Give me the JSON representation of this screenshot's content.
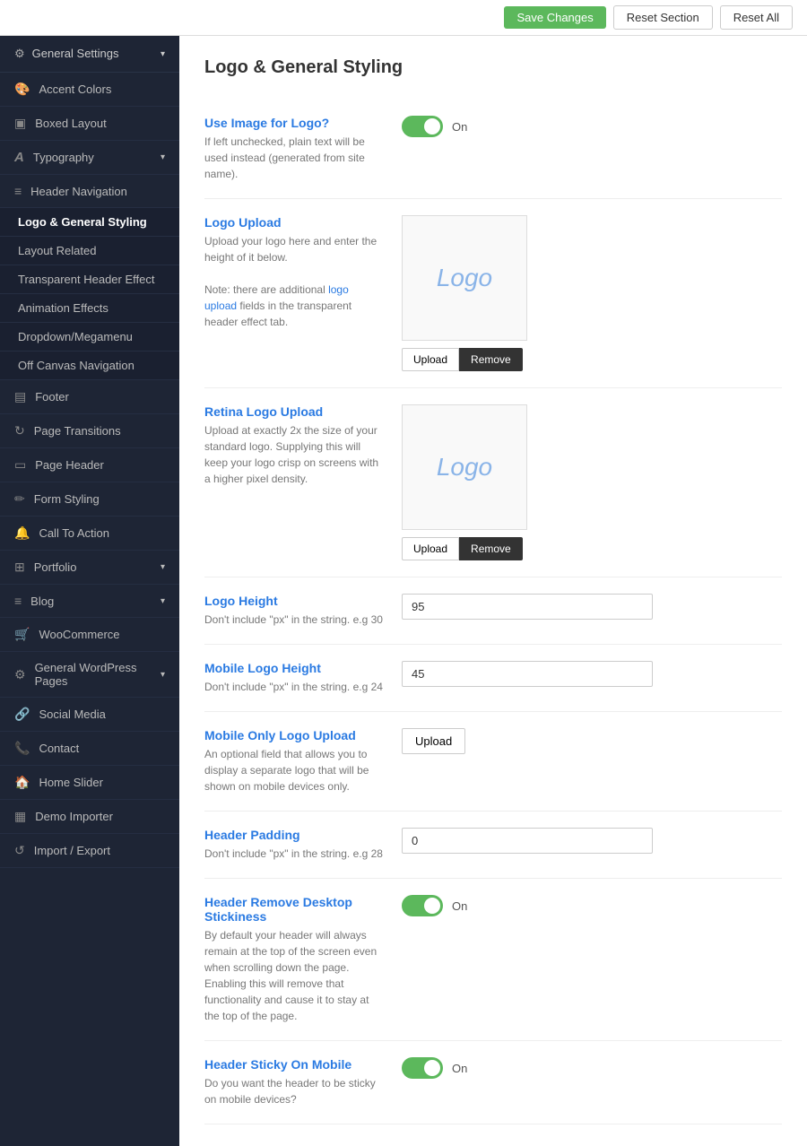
{
  "topbar": {
    "save_label": "Save Changes",
    "reset_section_label": "Reset Section",
    "reset_all_label": "Reset All"
  },
  "sidebar": {
    "section_title": "General Settings",
    "items": [
      {
        "id": "accent-colors",
        "label": "Accent Colors",
        "icon": "🎨"
      },
      {
        "id": "boxed-layout",
        "label": "Boxed Layout",
        "icon": "▣"
      },
      {
        "id": "typography",
        "label": "Typography",
        "icon": "A",
        "has_chevron": true
      },
      {
        "id": "header-navigation",
        "label": "Header Navigation",
        "icon": "≡"
      },
      {
        "id": "logo-general-styling",
        "label": "Logo & General Styling",
        "icon": null,
        "active": true
      },
      {
        "id": "layout-related",
        "label": "Layout Related",
        "icon": null
      },
      {
        "id": "transparent-header-effect",
        "label": "Transparent Header Effect",
        "icon": null
      },
      {
        "id": "animation-effects",
        "label": "Animation Effects",
        "icon": null
      },
      {
        "id": "dropdown-megamenu",
        "label": "Dropdown/Megamenu",
        "icon": null
      },
      {
        "id": "off-canvas-navigation",
        "label": "Off Canvas Navigation",
        "icon": null
      },
      {
        "id": "footer",
        "label": "Footer",
        "icon": "▤"
      },
      {
        "id": "page-transitions",
        "label": "Page Transitions",
        "icon": "↻"
      },
      {
        "id": "page-header",
        "label": "Page Header",
        "icon": "▭"
      },
      {
        "id": "form-styling",
        "label": "Form Styling",
        "icon": "✏"
      },
      {
        "id": "call-to-action",
        "label": "Call To Action",
        "icon": "🔔"
      },
      {
        "id": "portfolio",
        "label": "Portfolio",
        "icon": "⊞",
        "has_chevron": true
      },
      {
        "id": "blog",
        "label": "Blog",
        "icon": "≡",
        "has_chevron": true
      },
      {
        "id": "woocommerce",
        "label": "WooCommerce",
        "icon": "🛒"
      },
      {
        "id": "general-wordpress-pages",
        "label": "General WordPress Pages",
        "icon": "⚙",
        "has_chevron": true
      },
      {
        "id": "social-media",
        "label": "Social Media",
        "icon": "🔗"
      },
      {
        "id": "contact",
        "label": "Contact",
        "icon": "📞"
      },
      {
        "id": "home-slider",
        "label": "Home Slider",
        "icon": "🏠"
      },
      {
        "id": "demo-importer",
        "label": "Demo Importer",
        "icon": "▦"
      },
      {
        "id": "import-export",
        "label": "Import / Export",
        "icon": "↺"
      }
    ]
  },
  "main": {
    "page_title": "Logo & General Styling",
    "settings": [
      {
        "id": "use-image-for-logo",
        "label": "Use Image for Logo?",
        "description": "If left unchecked, plain text will be used instead (generated from site name).",
        "type": "toggle",
        "value": true,
        "toggle_on_label": "On"
      },
      {
        "id": "logo-upload",
        "label": "Logo Upload",
        "description": "Upload your logo here and enter the height of it below.\n\nNote: there are additional logo upload fields in the transparent header effect tab.",
        "type": "logo-upload",
        "logo_placeholder": "Logo",
        "upload_label": "Upload",
        "remove_label": "Remove"
      },
      {
        "id": "retina-logo-upload",
        "label": "Retina Logo Upload",
        "description": "Upload at exactly 2x the size of your standard logo. Supplying this will keep your logo crisp on screens with a higher pixel density.",
        "type": "logo-upload",
        "logo_placeholder": "Logo",
        "upload_label": "Upload",
        "remove_label": "Remove"
      },
      {
        "id": "logo-height",
        "label": "Logo Height",
        "description": "Don't include \"px\" in the string. e.g 30",
        "type": "text",
        "value": "95"
      },
      {
        "id": "mobile-logo-height",
        "label": "Mobile Logo Height",
        "description": "Don't include \"px\" in the string. e.g 24",
        "type": "text",
        "value": "45"
      },
      {
        "id": "mobile-only-logo-upload",
        "label": "Mobile Only Logo Upload",
        "description": "An optional field that allows you to display a separate logo that will be shown on mobile devices only.",
        "type": "upload-only",
        "upload_label": "Upload"
      },
      {
        "id": "header-padding",
        "label": "Header Padding",
        "description": "Don't include \"px\" in the string. e.g 28",
        "type": "text",
        "value": "0"
      },
      {
        "id": "header-remove-desktop-stickiness",
        "label": "Header Remove Desktop Stickiness",
        "description": "By default your header will always remain at the top of the screen even when scrolling down the page. Enabling this will remove that functionality and cause it to stay at the top of the page.",
        "type": "toggle",
        "value": true,
        "toggle_on_label": "On"
      },
      {
        "id": "header-sticky-on-mobile",
        "label": "Header Sticky On Mobile",
        "description": "Do you want the header to be sticky on mobile devices?",
        "type": "toggle",
        "value": true,
        "toggle_on_label": "On"
      }
    ]
  }
}
